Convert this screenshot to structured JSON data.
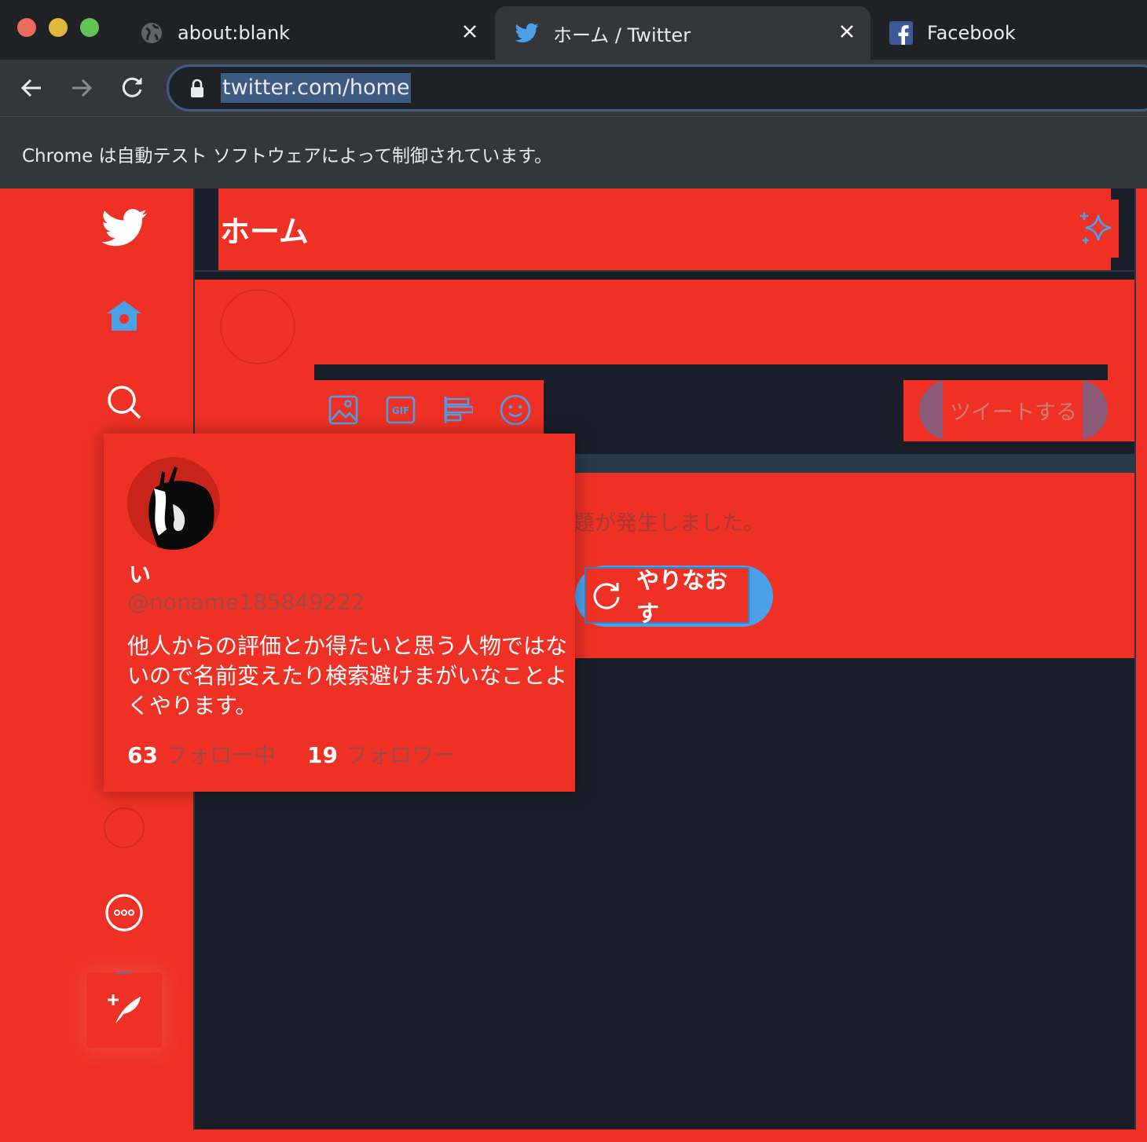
{
  "browser": {
    "tabs": [
      {
        "title": "about:blank",
        "favicon": "globe-icon"
      },
      {
        "title": "ホーム / Twitter",
        "favicon": "twitter-bird-icon"
      },
      {
        "title": "Facebook",
        "favicon": "facebook-icon"
      }
    ],
    "url": "twitter.com/home",
    "infobar": "Chrome は自動テスト ソフトウェアによって制御されています。"
  },
  "twitter": {
    "header_title": "ホーム",
    "tweet_button": "ツイートする",
    "error_text": "題が発生しました。",
    "retry_button": "やりなおす",
    "colors": {
      "accent": "#4ba0ea",
      "page_bg": "#ee3124",
      "column_bg": "#1a1e28"
    }
  },
  "hovercard": {
    "name": "い",
    "handle": "@noname185849222",
    "bio": "他人からの評価とか得たいと思う人物ではないので名前変えたり検索避けまがいなことよくやります。",
    "following_count": "63",
    "following_label": "フォロー中",
    "followers_count": "19",
    "followers_label": "フォロワー"
  }
}
